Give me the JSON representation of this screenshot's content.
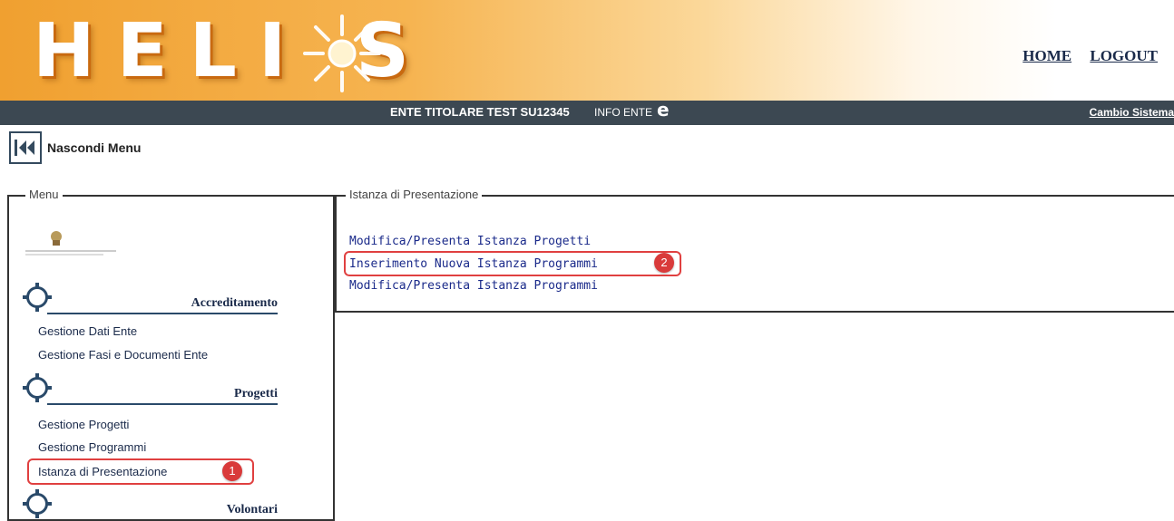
{
  "header": {
    "logo_text": "HELI S",
    "home_label": "HOME",
    "logout_label": "LOGOUT",
    "ente_label": "ENTE TITOLARE TEST  SU12345",
    "info_ente_label": "INFO ENTE",
    "cambio_sistema_label": "Cambio Sistema"
  },
  "hide_menu": {
    "label": "Nascondi Menu"
  },
  "menu": {
    "legend": "Menu",
    "sections": [
      {
        "title": "Accreditamento",
        "items": [
          "Gestione Dati Ente",
          "Gestione Fasi e Documenti Ente"
        ]
      },
      {
        "title": "Progetti",
        "items": [
          "Gestione Progetti",
          "Gestione Programmi",
          "Istanza di Presentazione"
        ]
      },
      {
        "title": "Volontari",
        "items": []
      }
    ]
  },
  "istanza": {
    "legend": "Istanza di Presentazione",
    "links": [
      "Modifica/Presenta Istanza Progetti",
      "Inserimento Nuova Istanza Programmi",
      "Modifica/Presenta Istanza Programmi"
    ]
  },
  "annotations": {
    "badge_1": "1",
    "badge_2": "2"
  },
  "colors": {
    "banner_orange": "#f0a030",
    "bar_dark": "#3c4852",
    "highlight_red": "#e04040"
  }
}
